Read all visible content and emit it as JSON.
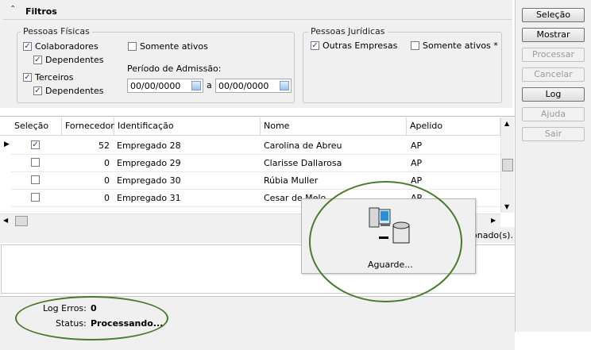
{
  "filters": {
    "title": "Filtros",
    "pf": {
      "legend": "Pessoas Físicas",
      "colaboradores": "Colaboradores",
      "dependentes1": "Dependentes",
      "terceiros": "Terceiros",
      "dependentes2": "Dependentes",
      "somente_ativos": "Somente ativos",
      "periodo_label": "Período de Admissão:",
      "date_from": "00/00/0000",
      "date_sep": "a",
      "date_to": "00/00/0000"
    },
    "pj": {
      "legend": "Pessoas Jurídicas",
      "outras_empresas": "Outras Empresas",
      "somente_ativos": "Somente ativos *"
    }
  },
  "grid": {
    "columns": [
      "Seleção",
      "Fornecedor",
      "Identificação",
      "Nome",
      "Apelido"
    ],
    "rows": [
      {
        "selected": true,
        "fornecedor": "52",
        "identificacao": "Empregado 28",
        "nome": "Carolina de Abreu",
        "apelido": "AP"
      },
      {
        "selected": false,
        "fornecedor": "0",
        "identificacao": "Empregado 29",
        "nome": "Clarisse Dallarosa",
        "apelido": "AP"
      },
      {
        "selected": false,
        "fornecedor": "0",
        "identificacao": "Empregado 30",
        "nome": "Rúbia Muller",
        "apelido": "AP"
      },
      {
        "selected": false,
        "fornecedor": "0",
        "identificacao": "Empregado 31",
        "nome": "Cesar de Melo",
        "apelido": "AP"
      }
    ],
    "status_tail": "onado(s)."
  },
  "popup": {
    "text": "Aguarde..."
  },
  "status": {
    "log_label": "Log Erros:",
    "log_value": "0",
    "status_label": "Status:",
    "status_value": "Processando..."
  },
  "buttons": {
    "selecao": "Seleção",
    "mostrar": "Mostrar",
    "processar": "Processar",
    "cancelar": "Cancelar",
    "log": "Log",
    "ajuda": "Ajuda",
    "sair": "Sair"
  },
  "colors": {
    "annotation": "#4a7a2e",
    "panel": "#f0f0f0"
  }
}
